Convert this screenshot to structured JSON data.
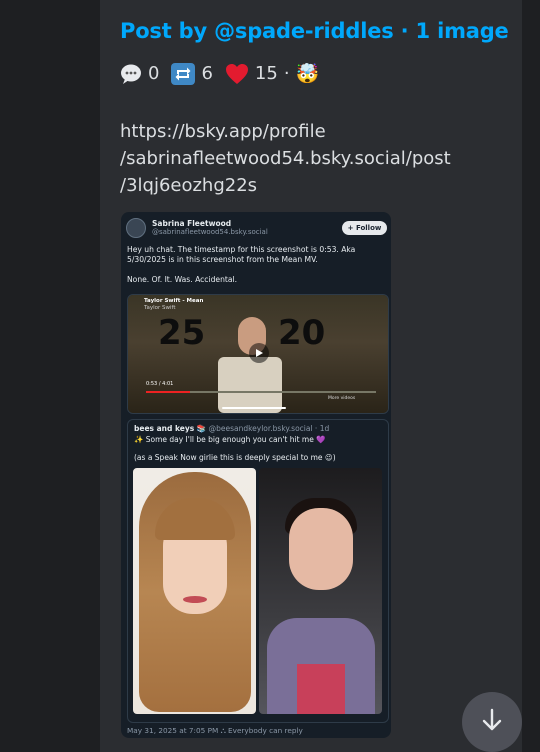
{
  "post": {
    "title": "Post by @spade-riddles · 1 image",
    "stats": {
      "comments": "0",
      "reposts": "6",
      "likes": "15",
      "separator": "·",
      "reaction_emoji": "🤯"
    },
    "url_lines": [
      "https://bsky.app/profile",
      "/sabrinafleetwood54.bsky.social/post",
      "/3lqj6eozhg22s"
    ]
  },
  "screenshot": {
    "author_name": "Sabrina Fleetwood",
    "author_handle": "@sabrinafleetwood54.bsky.social",
    "follow_label": "+ Follow",
    "text_lines": [
      "Hey uh chat. The timestamp for this screenshot is 0:53. Aka",
      "5/30/2025 is in this screenshot from the Mean MV.",
      "",
      "None. Of. It. Was. Accidental."
    ],
    "video": {
      "title": "Taylor Swift - Mean",
      "channel": "Taylor Swift",
      "time": "0:53 / 4:01",
      "more_videos": "More videos"
    },
    "quote": {
      "author_name": "bees and keys 📚",
      "author_handle": "@beesandkeylor.bsky.social · 1d",
      "line1": "✨ Some day I'll be big enough you can't hit me 💜",
      "line2": "(as a Speak Now girlie this is deeply special to me 😉)"
    },
    "footer": "May 31, 2025 at 7:05 PM  ⛬ Everybody can reply"
  },
  "colors": {
    "link_blue": "#00a8fc",
    "text": "#dbdee1",
    "card_bg": "#2b2d31",
    "page_bg": "#1e1f22"
  }
}
